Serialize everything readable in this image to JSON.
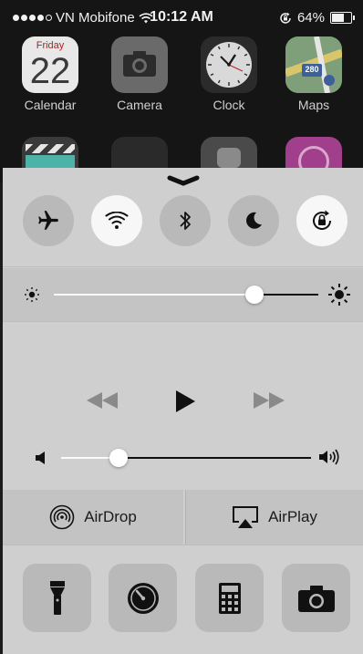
{
  "status_bar": {
    "carrier": "VN Mobifone",
    "time": "10:12 AM",
    "battery": "64%",
    "signal_icon": "signal-dots-icon",
    "wifi_icon": "wifi-icon",
    "orientation_lock_icon": "rotation-lock-icon",
    "battery_level": 0.64
  },
  "home_screen": {
    "apps": [
      {
        "name": "Calendar",
        "day": "Friday",
        "date": "22"
      },
      {
        "name": "Camera"
      },
      {
        "name": "Clock"
      },
      {
        "name": "Maps",
        "badge_text": "280"
      }
    ]
  },
  "control_center": {
    "toggles": [
      {
        "icon": "airplane-icon",
        "state": "off"
      },
      {
        "icon": "wifi-icon",
        "state": "on"
      },
      {
        "icon": "bluetooth-icon",
        "state": "off"
      },
      {
        "icon": "moon-icon",
        "state": "off"
      },
      {
        "icon": "rotation-lock-icon",
        "state": "on"
      }
    ],
    "brightness": {
      "level": 0.76
    },
    "media": {
      "previous_icon": "rewind-icon",
      "play_icon": "play-icon",
      "next_icon": "fast-forward-icon"
    },
    "volume": {
      "level": 0.23
    },
    "airdrop_label": "AirDrop",
    "airplay_label": "AirPlay",
    "tools": [
      {
        "icon": "flashlight-icon"
      },
      {
        "icon": "timer-icon"
      },
      {
        "icon": "calculator-icon"
      },
      {
        "icon": "camera-icon"
      }
    ]
  }
}
